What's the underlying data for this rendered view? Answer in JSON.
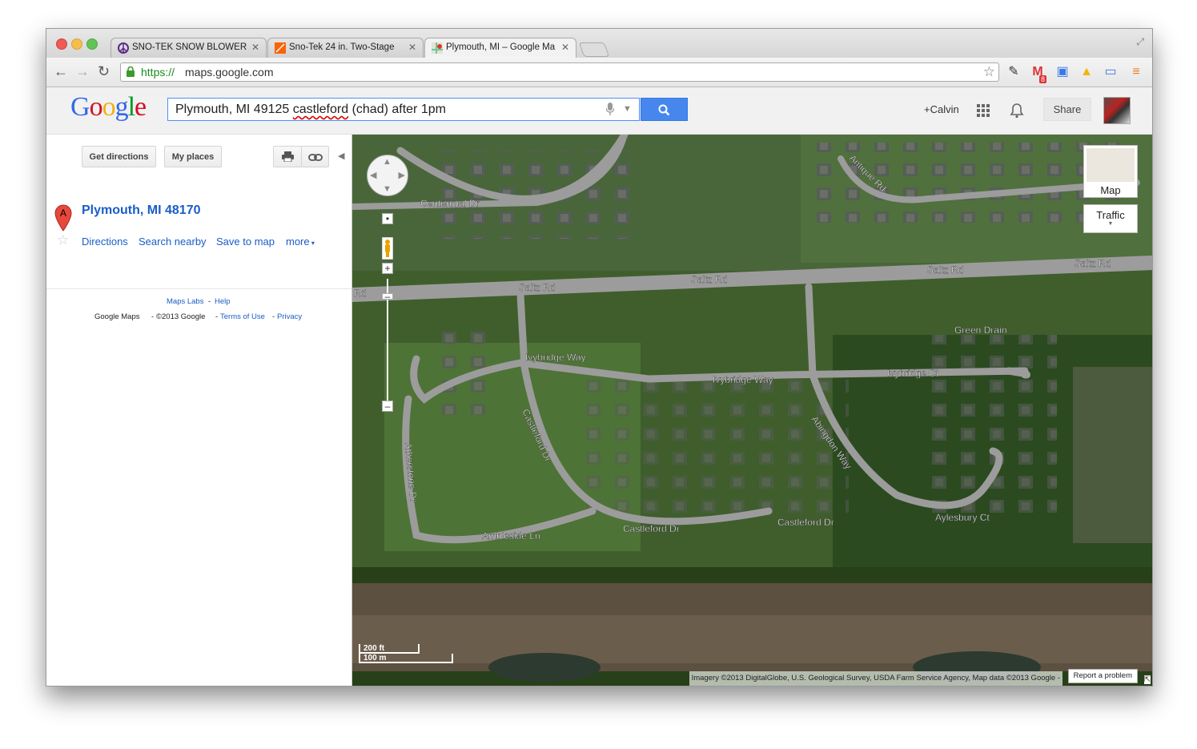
{
  "browser": {
    "tabs": [
      {
        "title": "SNO-TEK SNOW BLOWER",
        "active": false
      },
      {
        "title": "Sno-Tek 24 in. Two-Stage",
        "active": false
      },
      {
        "title": "Plymouth, MI – Google Ma",
        "active": true
      }
    ],
    "url_protocol": "https://",
    "url_host": "maps.google.com",
    "gmail_badge": "8"
  },
  "header": {
    "logo": "Google",
    "search_prefix": "Plymouth, MI 49125 ",
    "search_misspelled": "castleford",
    "search_suffix": " (chad) after 1pm",
    "user_name": "+Calvin",
    "share_label": "Share"
  },
  "left": {
    "get_directions": "Get directions",
    "my_places": "My places",
    "pin_letter": "A",
    "place_title": "Plymouth, MI 48170",
    "links": {
      "directions": "Directions",
      "search_nearby": "Search nearby",
      "save_to_map": "Save to map",
      "more": "more"
    },
    "footer": {
      "maps_labs": "Maps Labs",
      "help": "Help",
      "google_maps": "Google Maps",
      "copyright": "©2013 Google",
      "terms": "Terms of Use",
      "privacy": "Privacy"
    }
  },
  "map": {
    "map_type": "Map",
    "traffic": "Traffic",
    "scale_ft": "200 ft",
    "scale_m": "100 m",
    "attribution": "Imagery ©2013 DigitalGlobe, U.S. Geological Survey, USDA Farm Service Agency, Map data ©2013 Google -",
    "report": "Report a problem",
    "roads": [
      "Centennial Dr",
      "Antique Rd",
      "Saltz Rd",
      "Saltz Rd",
      "Saltz Rd",
      "Saltz Rd",
      "Rd",
      "Green Drain",
      "Ivybridge Way",
      "Ivybridge Way",
      "Ivybridge Ct",
      "Castleford Dr",
      "Castleford Dr",
      "Castleford Dr",
      "Abingdon Way",
      "Atherstone Dr",
      "Ambleside Ln",
      "Aylesbury Ct"
    ]
  },
  "colors": {
    "link": "#1a5dc7",
    "search_button": "#4787ed",
    "url_green": "#1b8c1b"
  }
}
